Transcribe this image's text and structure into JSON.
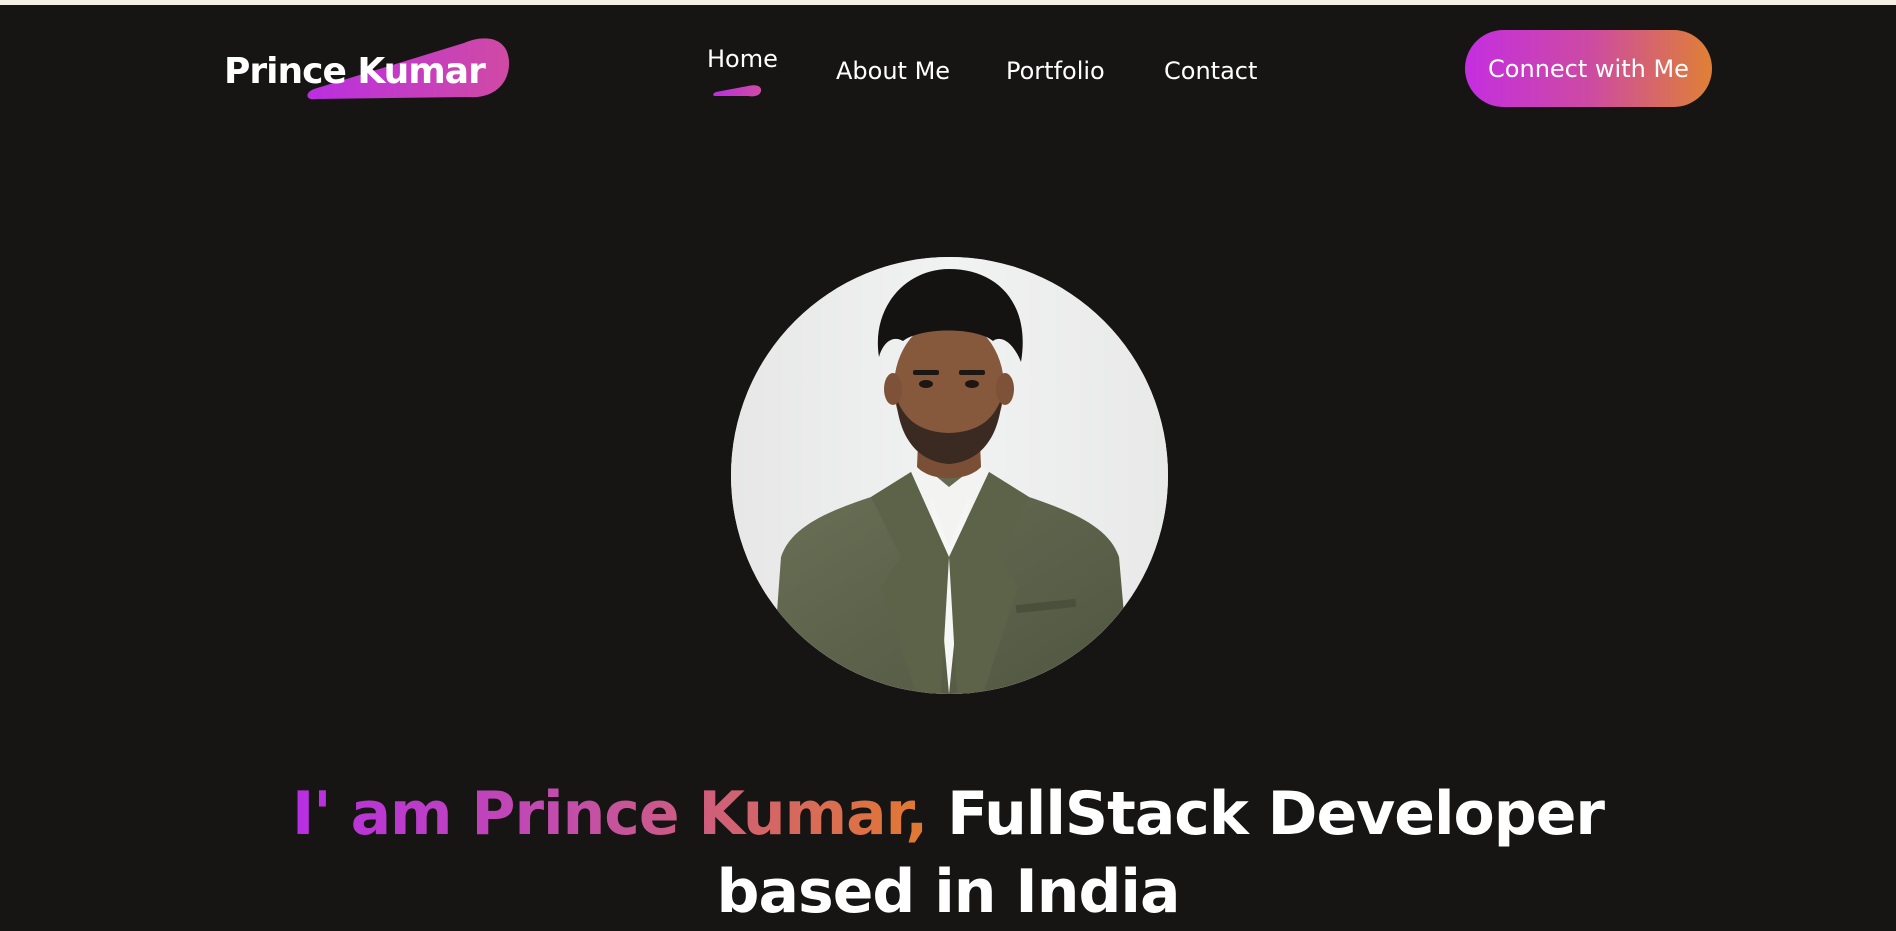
{
  "brand": {
    "name": "Prince Kumar"
  },
  "nav": {
    "items": [
      {
        "label": "Home"
      },
      {
        "label": "About Me"
      },
      {
        "label": "Portfolio"
      },
      {
        "label": "Contact"
      }
    ],
    "active": "Home"
  },
  "cta": {
    "label": "Connect with Me"
  },
  "hero": {
    "intro": "I' am Prince Kumar,",
    "role": "FullStack Developer",
    "location_line": "based in India"
  },
  "colors": {
    "background": "#161514",
    "gradient_start": "#c42ee0",
    "gradient_mid": "#cd4aa3",
    "gradient_end": "#df8035",
    "text": "#ffffff"
  }
}
